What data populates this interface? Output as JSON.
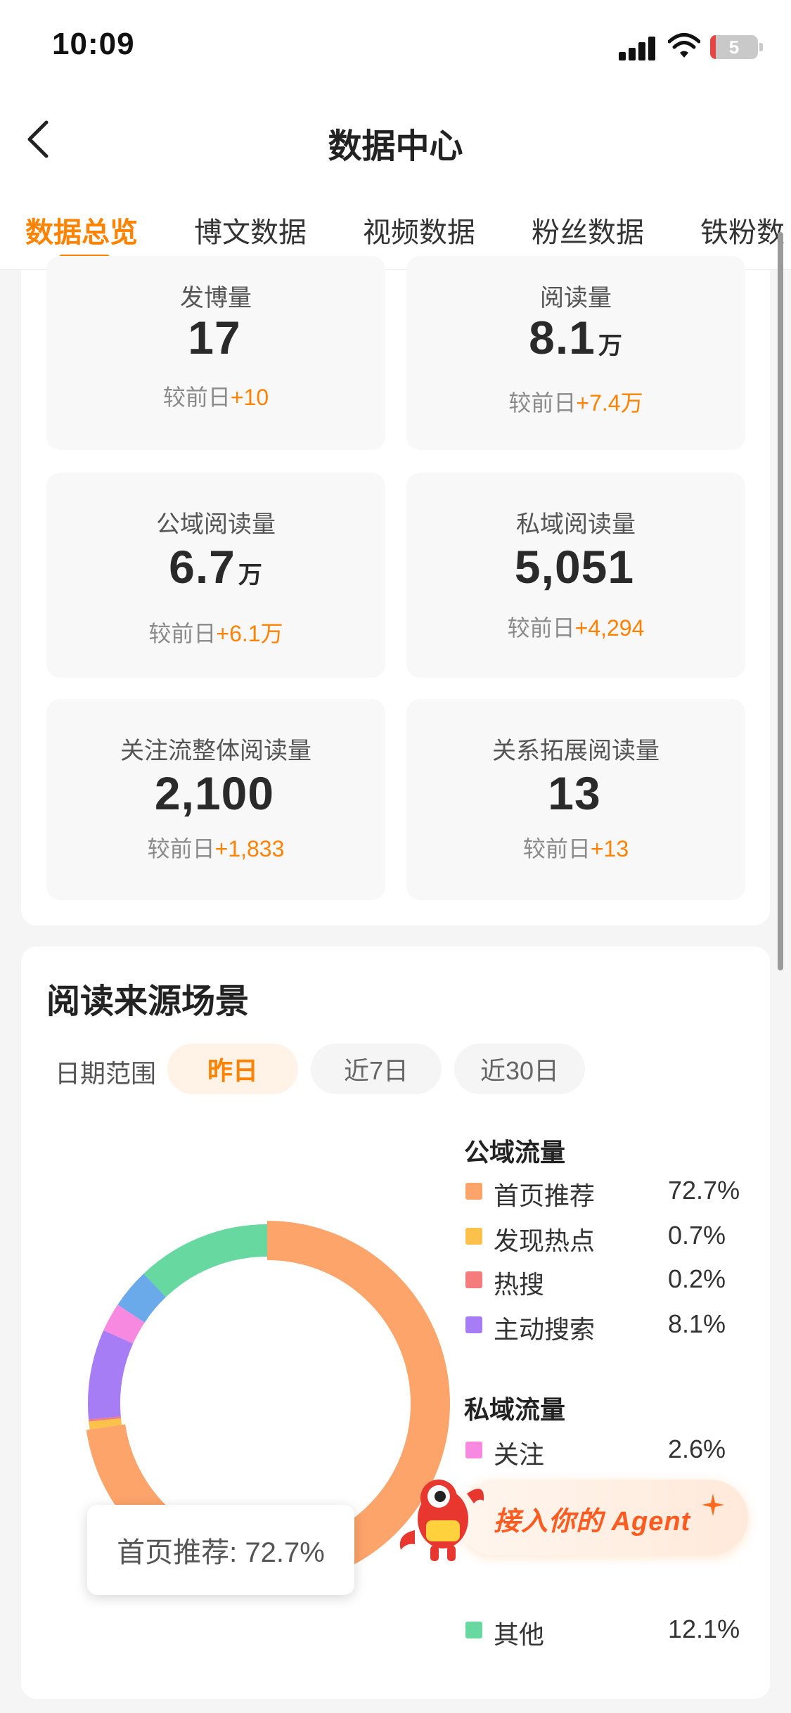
{
  "status_bar": {
    "time": "10:09",
    "battery": "5"
  },
  "nav": {
    "title": "数据中心"
  },
  "tabs": [
    {
      "label": "数据总览"
    },
    {
      "label": "博文数据"
    },
    {
      "label": "视频数据"
    },
    {
      "label": "粉丝数据"
    },
    {
      "label": "铁粉数"
    }
  ],
  "metrics": [
    {
      "label": "发博量",
      "value": "17",
      "unit": "",
      "delta_prefix": "较前日",
      "delta": "+10"
    },
    {
      "label": "阅读量",
      "value": "8.1",
      "unit": "万",
      "delta_prefix": "较前日",
      "delta": "+7.4万"
    },
    {
      "label": "公域阅读量",
      "value": "6.7",
      "unit": "万",
      "delta_prefix": "较前日",
      "delta": "+6.1万"
    },
    {
      "label": "私域阅读量",
      "value": "5,051",
      "unit": "",
      "delta_prefix": "较前日",
      "delta": "+4,294"
    },
    {
      "label": "关注流整体阅读量",
      "value": "2,100",
      "unit": "",
      "delta_prefix": "较前日",
      "delta": "+1,833"
    },
    {
      "label": "关系拓展阅读量",
      "value": "13",
      "unit": "",
      "delta_prefix": "较前日",
      "delta": "+13"
    }
  ],
  "source": {
    "title": "阅读来源场景",
    "range_label": "日期范围",
    "ranges": [
      {
        "label": "昨日",
        "active": true
      },
      {
        "label": "近7日",
        "active": false
      },
      {
        "label": "近30日",
        "active": false
      }
    ],
    "tooltip": "首页推荐: 72.7%",
    "public_title": "公域流量",
    "private_title": "私域流量",
    "legend_public": [
      {
        "name": "首页推荐",
        "pct": "72.7%",
        "color": "#fca46a"
      },
      {
        "name": "发现热点",
        "pct": "0.7%",
        "color": "#fcc14a"
      },
      {
        "name": "热搜",
        "pct": "0.2%",
        "color": "#f47c7c"
      },
      {
        "name": "主动搜索",
        "pct": "8.1%",
        "color": "#a77df5"
      }
    ],
    "legend_private": [
      {
        "name": "关注",
        "pct": "2.6%",
        "color": "#f889e0"
      },
      {
        "name": "其他",
        "pct": "12.1%",
        "color": "#67d8a0"
      }
    ],
    "agent_button": "接入你的 Agent"
  },
  "chart_data": {
    "type": "pie",
    "categories": [
      "首页推荐",
      "发现热点",
      "热搜",
      "主动搜索",
      "关注",
      "其他"
    ],
    "values": [
      72.7,
      0.7,
      0.2,
      8.1,
      2.6,
      12.1
    ],
    "colors": [
      "#fca46a",
      "#fcc14a",
      "#f47c7c",
      "#a77df5",
      "#f889e0",
      "#67d8a0"
    ],
    "extra_segment_color": "#6aa9ea"
  }
}
